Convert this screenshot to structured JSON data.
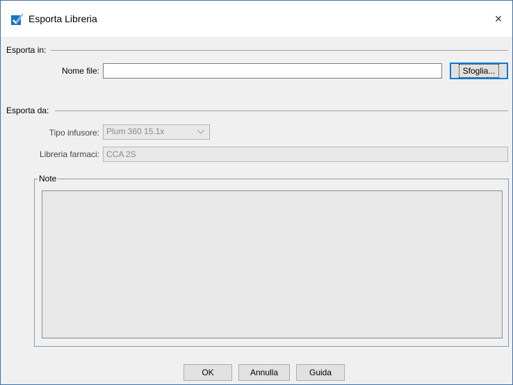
{
  "window": {
    "title": "Esporta Libreria",
    "close_symbol": "×"
  },
  "export_to": {
    "section_label": "Esporta in:",
    "file_name_label": "Nome file:",
    "file_name_value": "",
    "browse_label": "Sfoglia..."
  },
  "export_from": {
    "section_label": "Esporta da:",
    "pump_type_label": "Tipo infusore:",
    "pump_type_value": "Plum 360 15.1x",
    "library_label": "Libreria farmaci:",
    "library_value": "CCA 2S"
  },
  "notes": {
    "legend": "Note",
    "value": ""
  },
  "buttons": {
    "ok_label": "OK",
    "cancel_label": "Annulla",
    "help_label": "Guida"
  },
  "colors": {
    "accent": "#0078d7",
    "check_icon": "#1a73c8"
  },
  "icons": {
    "app": "checkbox-check-icon",
    "close": "close-icon",
    "dropdown": "chevron-down-icon"
  }
}
